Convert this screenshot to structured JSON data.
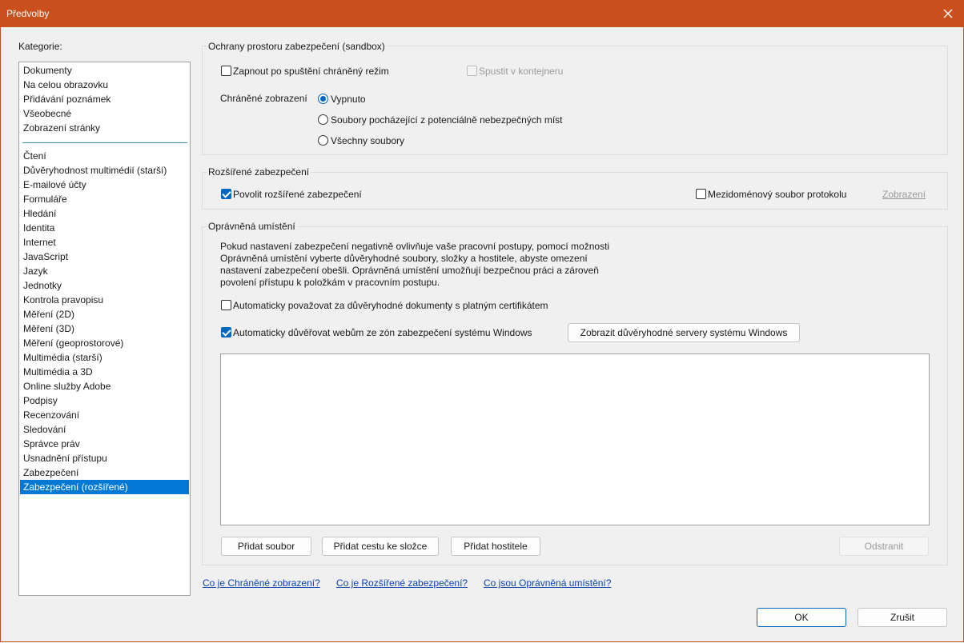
{
  "window": {
    "title": "Předvolby"
  },
  "categories": {
    "label": "Kategorie:",
    "top_items": [
      "Dokumenty",
      "Na celou obrazovku",
      "Přidávání poznámek",
      "Všeobecné",
      "Zobrazení stránky"
    ],
    "items": [
      "Čtení",
      "Důvěryhodnost multimédií (starší)",
      "E-mailové účty",
      "Formuláře",
      "Hledání",
      "Identita",
      "Internet",
      "JavaScript",
      "Jazyk",
      "Jednotky",
      "Kontrola pravopisu",
      "Měření (2D)",
      "Měření (3D)",
      "Měření (geoprostorové)",
      "Multimédia (starší)",
      "Multimédia a 3D",
      "Online služby Adobe",
      "Podpisy",
      "Recenzování",
      "Sledování",
      "Správce práv",
      "Usnadnění přístupu",
      "Zabezpečení",
      "Zabezpečení (rozšířené)"
    ],
    "selected": "Zabezpečení (rozšířené)"
  },
  "sandbox": {
    "title": "Ochrany prostoru zabezpečení (sandbox)",
    "protected_mode": {
      "label": "Zapnout po spuštění chráněný režim",
      "checked": false
    },
    "container": {
      "label": "Spustit v kontejneru",
      "checked": false,
      "disabled": true
    },
    "protected_view_label": "Chráněné zobrazení",
    "protected_view_options": [
      {
        "label": "Vypnuto",
        "selected": true
      },
      {
        "label": "Soubory pocházející z potenciálně nebezpečných míst",
        "selected": false
      },
      {
        "label": "Všechny soubory",
        "selected": false
      }
    ]
  },
  "enhanced": {
    "title": "Rozšířené zabezpečení",
    "enable": {
      "label": "Povolit rozšířené zabezpečení",
      "checked": true
    },
    "crossdomain": {
      "label": "Mezidoménový soubor protokolu",
      "checked": false
    },
    "view_link": "Zobrazení"
  },
  "privileged": {
    "title": "Oprávněná umístění",
    "description": "Pokud nastavení zabezpečení negativně ovlivňuje vaše pracovní postupy, pomocí možnosti Oprávněná umístění vyberte důvěryhodné soubory, složky a hostitele, abyste omezení nastavení zabezpečení obešli. Oprávněná umístění umožňují bezpečnou práci a zároveň povolení přístupu k položkám v pracovním postupu.",
    "auto_cert": {
      "label": "Automaticky považovat za důvěryhodné dokumenty s platným certifikátem",
      "checked": false
    },
    "auto_trust": {
      "label": "Automaticky důvěřovat webům ze zón zabezpečení systému Windows",
      "checked": true
    },
    "show_servers_button": "Zobrazit důvěryhodné servery systému Windows",
    "buttons": {
      "add_file": "Přidat soubor",
      "add_folder": "Přidat cestu ke složce",
      "add_host": "Přidat hostitele",
      "remove": "Odstranit"
    }
  },
  "help_links": [
    "Co je Chráněné zobrazení?",
    "Co je Rozšířené zabezpečení?",
    "Co jsou Oprávněná umístění?"
  ],
  "footer": {
    "ok": "OK",
    "cancel": "Zrušit"
  },
  "colors": {
    "title_bar": "#c9501c",
    "selection": "#0078d4",
    "link": "#0b43b0",
    "check_accent": "#0067c0"
  }
}
